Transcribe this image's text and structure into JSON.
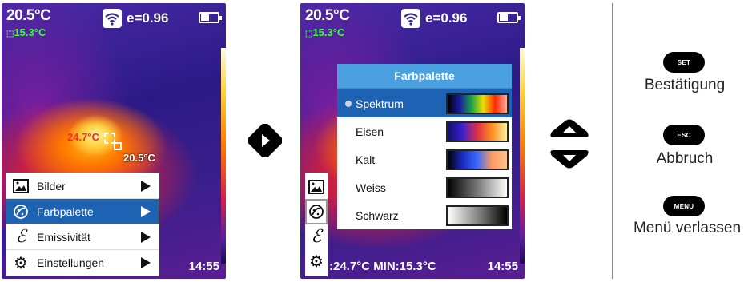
{
  "screen1": {
    "temp_main": "20.5°C",
    "temp_sub": "15.3°C",
    "emissivity": "e=0.96",
    "spot_left": "24.7°C",
    "spot_right": "20.5°C",
    "time": "14:55",
    "menu": [
      {
        "label": "Bilder",
        "icon": "pictures-icon"
      },
      {
        "label": "Farbpalette",
        "icon": "palette-icon"
      },
      {
        "label": "Emissivität",
        "icon": "epsilon-icon"
      },
      {
        "label": "Einstellungen",
        "icon": "gear-icon"
      }
    ]
  },
  "screen2": {
    "temp_main": "20.5°C",
    "temp_sub": "15.3°C",
    "emissivity": "e=0.96",
    "minmax": ":24.7°C  MIN:15.3°C",
    "time": "14:55",
    "palette_title": "Farbpalette",
    "palettes": [
      {
        "label": "Spektrum",
        "selected": true
      },
      {
        "label": "Eisen",
        "selected": false
      },
      {
        "label": "Kalt",
        "selected": false
      },
      {
        "label": "Weiss",
        "selected": false
      },
      {
        "label": "Schwarz",
        "selected": false
      }
    ]
  },
  "keys": [
    {
      "key": "SET",
      "label": "Bestätigung"
    },
    {
      "key": "ESC",
      "label": "Abbruch"
    },
    {
      "key": "MENU",
      "label": "Menü verlassen"
    }
  ],
  "colors": {
    "menu_active": "#1e63b3",
    "dialog_title": "#4ba1df",
    "sub_temp_green": "#3cff3c"
  }
}
